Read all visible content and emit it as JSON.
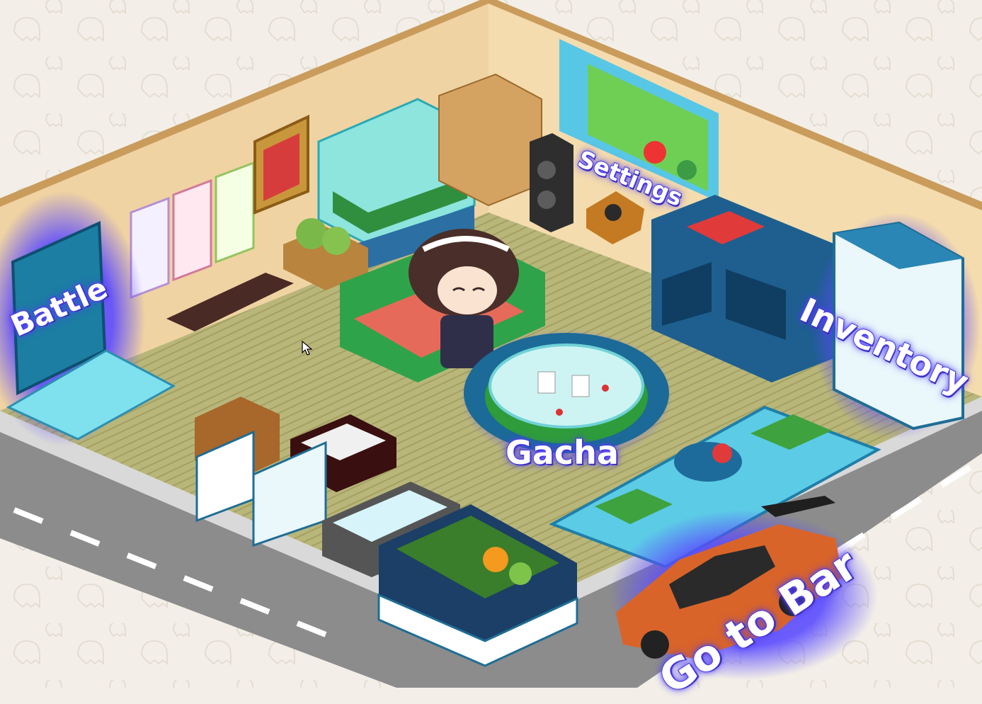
{
  "scene": {
    "type": "isometric-room",
    "colors": {
      "background": "#f3efe8",
      "road": "#8a8a8a",
      "floor": "#b8b57a",
      "wall": "#f1d6a6",
      "nav_glow": "#4a3cf0"
    }
  },
  "nav": {
    "battle": "Battle",
    "settings": "Settings",
    "inventory": "Inventory",
    "gacha": "Gacha",
    "go_to_bar": "Go to Bar"
  },
  "icons": {
    "cursor": "arrow-cursor-icon"
  }
}
